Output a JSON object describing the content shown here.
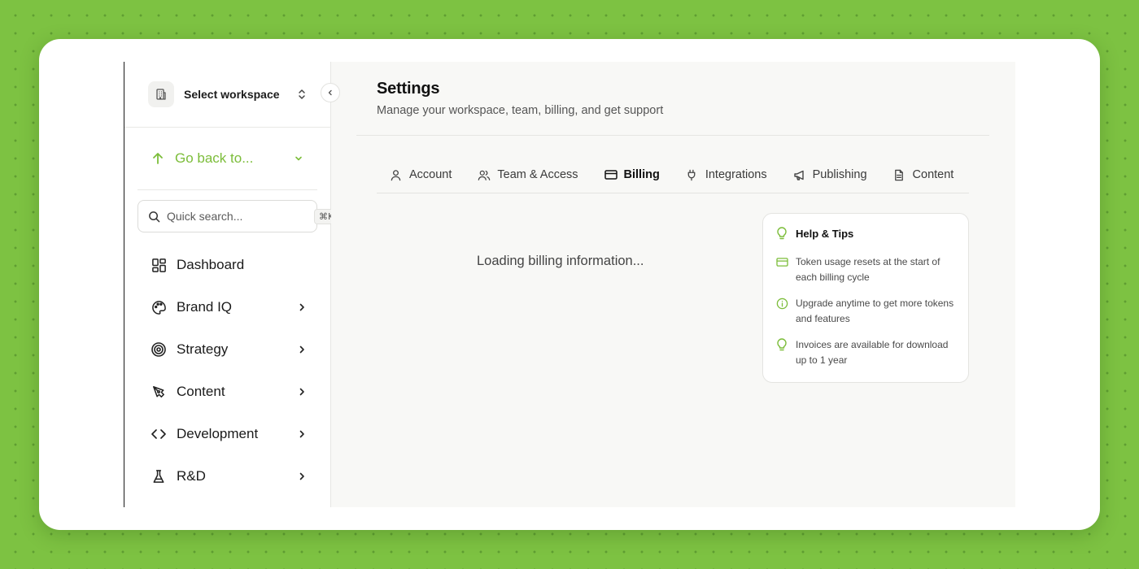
{
  "sidebar": {
    "workspace_label": "Select workspace",
    "go_back_label": "Go back to...",
    "search": {
      "placeholder": "Quick search...",
      "shortcut": "⌘K"
    },
    "items": [
      {
        "label": "Dashboard",
        "icon": "dashboard-icon"
      },
      {
        "label": "Brand IQ",
        "icon": "palette-icon"
      },
      {
        "label": "Strategy",
        "icon": "target-icon"
      },
      {
        "label": "Content",
        "icon": "pen-tool-icon"
      },
      {
        "label": "Development",
        "icon": "code-icon"
      },
      {
        "label": "R&D",
        "icon": "flask-icon"
      }
    ]
  },
  "header": {
    "title": "Settings",
    "subtitle": "Manage your workspace, team, billing, and get support"
  },
  "tabs": [
    {
      "label": "Account",
      "icon": "user-icon"
    },
    {
      "label": "Team & Access",
      "icon": "users-icon"
    },
    {
      "label": "Billing",
      "icon": "credit-card-icon",
      "active": true
    },
    {
      "label": "Integrations",
      "icon": "plug-icon"
    },
    {
      "label": "Publishing",
      "icon": "megaphone-icon"
    },
    {
      "label": "Content",
      "icon": "file-icon"
    }
  ],
  "main": {
    "loading_text": "Loading billing information..."
  },
  "tips": {
    "title": "Help & Tips",
    "items": [
      {
        "text": "Token usage resets at the start of each billing cycle",
        "icon": "credit-card-icon"
      },
      {
        "text": "Upgrade anytime to get more tokens and features",
        "icon": "info-icon"
      },
      {
        "text": "Invoices are available for download up to 1 year",
        "icon": "lightbulb-icon"
      }
    ]
  },
  "colors": {
    "accent": "#7cbd3a",
    "background": "#7dc242",
    "main_bg": "#f8f8f6"
  }
}
